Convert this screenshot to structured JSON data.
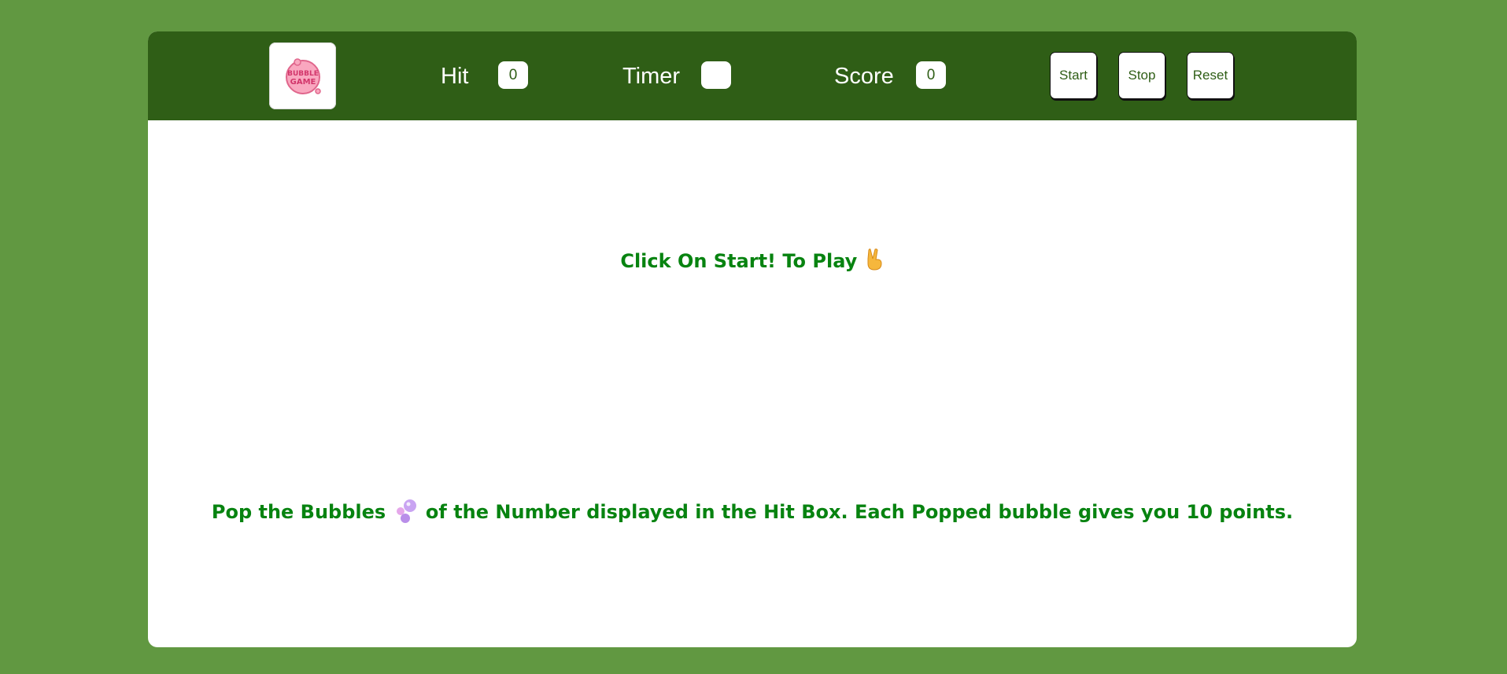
{
  "header": {
    "logo_text_line1": "BUBBLE",
    "logo_text_line2": "GAME",
    "hit": {
      "label": "Hit",
      "value": "0"
    },
    "timer": {
      "label": "Timer",
      "value": ""
    },
    "score": {
      "label": "Score",
      "value": "0"
    },
    "buttons": {
      "start": "Start",
      "stop": "Stop",
      "reset": "Reset"
    }
  },
  "main": {
    "start_message": "Click On Start! To Play",
    "start_icon": "victory-hand-icon",
    "instruction_part1": "Pop the Bubbles",
    "instruction_icon": "bubbles-icon",
    "instruction_part2": "of the Number displayed in the Hit Box. Each Popped bubble gives you 10 points."
  },
  "colors": {
    "page_background": "#619841",
    "header_background": "#2f5e16",
    "panel_background": "#ffffff",
    "message_text": "#078310"
  }
}
